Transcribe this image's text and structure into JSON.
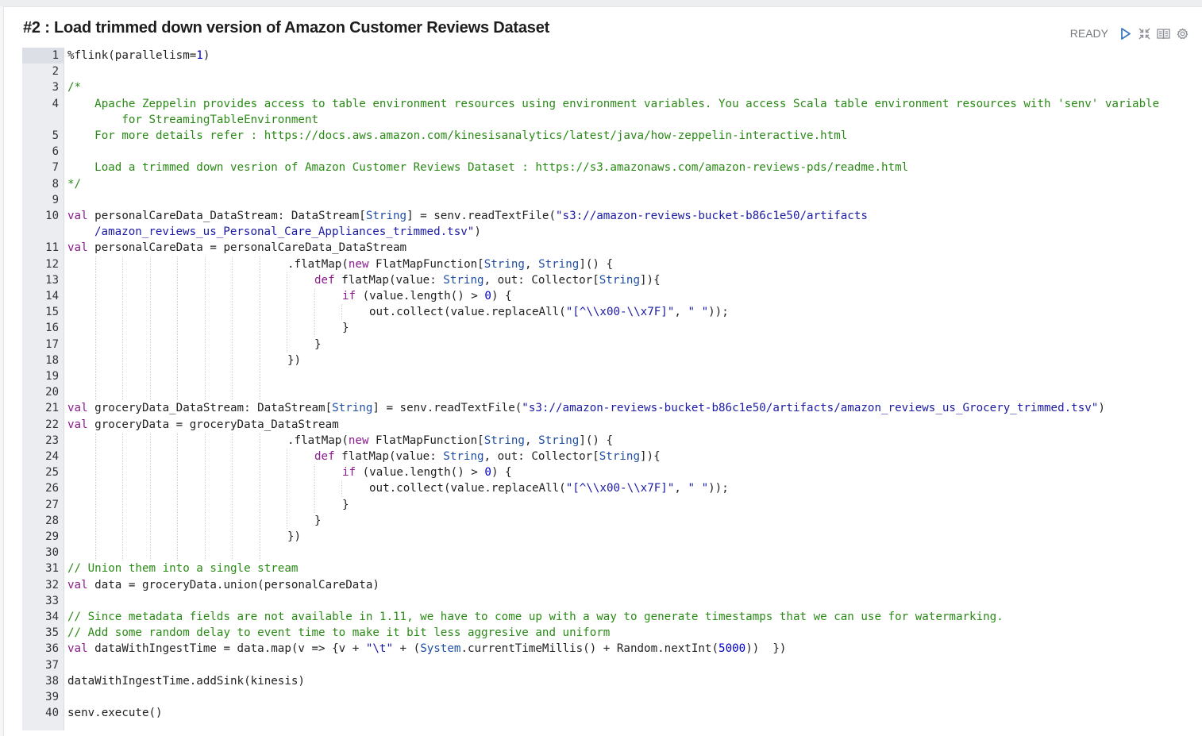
{
  "paragraph": {
    "title": "#2 : Load trimmed down version of Amazon Customer Reviews Dataset",
    "status": "READY",
    "icons": [
      "run-icon",
      "collapse-icon",
      "book-icon",
      "settings-icon"
    ]
  },
  "editor": {
    "line_numbers": [
      "1",
      "2",
      "3",
      "4",
      "5",
      "6",
      "7",
      "8",
      "9",
      "10",
      "11",
      "12",
      "13",
      "14",
      "15",
      "16",
      "17",
      "18",
      "19",
      "20",
      "21",
      "22",
      "23",
      "24",
      "25",
      "26",
      "27",
      "28",
      "29",
      "30",
      "31",
      "32",
      "33",
      "34",
      "35",
      "36",
      "37",
      "38",
      "39",
      "40"
    ],
    "code": {
      "l1a": "%flink(parallelism=",
      "l1b": "1",
      "l1c": ")",
      "l3": "/*",
      "l4a": "    Apache Zeppelin provides access to table environment resources using environment variables. You access Scala table environment resources with 'senv' variable",
      "l4b": "        for StreamingTableEnvironment",
      "l5": "    For more details refer : https://docs.aws.amazon.com/kinesisanalytics/latest/java/how-zeppelin-interactive.html",
      "l7": "    Load a trimmed down vesrion of Amazon Customer Reviews Dataset : https://s3.amazonaws.com/amazon-reviews-pds/readme.html",
      "l8": "*/",
      "l10_kw": "val",
      "l10a": " personalCareData_DataStream: DataStream[",
      "l10_ty": "String",
      "l10b": "] = senv.readTextFile(",
      "l10_st1": "\"s3://amazon-reviews-bucket-b86c1e50/artifacts",
      "l10_st2": "/amazon_reviews_us_Personal_Care_Appliances_trimmed.tsv\"",
      "l10c": ")",
      "l11_kw": "val",
      "l11a": " personalCareData = personalCareData_DataStream",
      "fm_a": ".flatMap(",
      "fm_kw": "new",
      "fm_b": " FlatMapFunction[",
      "fm_ty1": "String",
      "fm_c": ", ",
      "fm_ty2": "String",
      "fm_d": "]() {",
      "def_kw": "def",
      "def_a": " flatMap(value: ",
      "def_ty1": "String",
      "def_b": ", out: Collector[",
      "def_ty2": "String",
      "def_c": "]){",
      "if_kw": "if",
      "if_a": " (value.length() > ",
      "if_n": "0",
      "if_b": ") {",
      "oc_a": "out.collect(value.replaceAll(",
      "oc_st1": "\"[^\\\\x00-\\\\x7F]\"",
      "oc_b": ", ",
      "oc_st2": "\" \"",
      "oc_c": "));",
      "close1": "}",
      "close2": "}",
      "close3": "})",
      "l21_kw": "val",
      "l21a": " groceryData_DataStream: DataStream[",
      "l21_ty": "String",
      "l21b": "] = senv.readTextFile(",
      "l21_st": "\"s3://amazon-reviews-bucket-b86c1e50/artifacts/amazon_reviews_us_Grocery_trimmed.tsv\"",
      "l21c": ")",
      "l22_kw": "val",
      "l22a": " groceryData = groceryData_DataStream",
      "l31": "// Union them into a single stream",
      "l32_kw": "val",
      "l32a": " data = groceryData.union(personalCareData)",
      "l34": "// Since metadata fields are not available in 1.11, we have to come up with a way to generate timestamps that we can use for watermarking.",
      "l35": "// Add some random delay to event time to make it bit less aggresive and uniform",
      "l36_kw": "val",
      "l36a": " dataWithIngestTime = data.map(v => {v + ",
      "l36_st": "\"\\t\"",
      "l36b": " + (",
      "l36_ty": "System",
      "l36c": ".currentTimeMillis() + Random.nextInt(",
      "l36_n": "5000",
      "l36d": "))  })",
      "l38": "dataWithIngestTime.addSink(kinesis)",
      "l40": "senv.execute()"
    }
  }
}
